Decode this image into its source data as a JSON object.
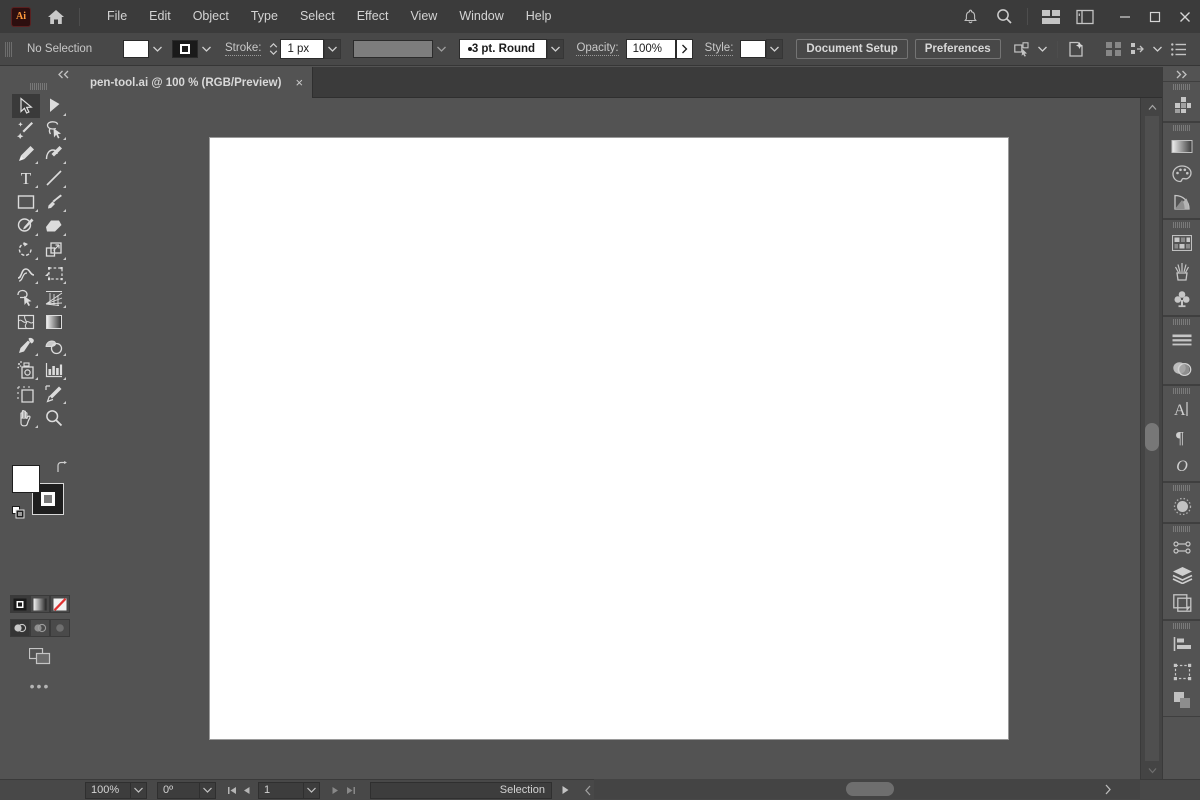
{
  "app": {
    "name": "Adobe Illustrator",
    "logo_text": "Ai",
    "accent": "#ff9a3c",
    "chrome_bg": "#3b3b3b",
    "panel_bg": "#535353",
    "control_bg": "#484848"
  },
  "menubar": {
    "items": [
      {
        "label": "File"
      },
      {
        "label": "Edit"
      },
      {
        "label": "Object"
      },
      {
        "label": "Type"
      },
      {
        "label": "Select"
      },
      {
        "label": "Effect"
      },
      {
        "label": "View"
      },
      {
        "label": "Window"
      },
      {
        "label": "Help"
      }
    ],
    "right_icons": [
      "bell-icon",
      "search-icon",
      "arrange-documents-icon",
      "workspace-switcher-icon"
    ],
    "window_controls": [
      "minimize",
      "maximize",
      "close"
    ]
  },
  "controlbar": {
    "selection_status": "No Selection",
    "fill_color": "#ffffff",
    "stroke_swatch": "#1a1a1a",
    "stroke_label": "Stroke:",
    "stroke_width": "1 px",
    "brush_definition": "3 pt. Round",
    "opacity_label": "Opacity:",
    "opacity_value": "100%",
    "style_label": "Style:",
    "style_swatch": "#ffffff",
    "document_setup_button": "Document Setup",
    "preferences_button": "Preferences",
    "right_icons": [
      "align-icon",
      "distribute-icon",
      "options-menu-icon",
      "select-similar-icon",
      "new-document-icon"
    ]
  },
  "tabs": [
    {
      "title": "pen-tool.ai @ 100 % (RGB/Preview)",
      "close_glyph": "×",
      "active": true
    }
  ],
  "toolbar": {
    "collapse_icon": "double-chevron-left-icon",
    "tools": [
      {
        "name": "selection-tool",
        "selected": true,
        "has_flyout": false
      },
      {
        "name": "direct-selection-tool",
        "selected": false,
        "has_flyout": true
      },
      {
        "name": "magic-wand-tool",
        "selected": false,
        "has_flyout": false
      },
      {
        "name": "lasso-tool",
        "selected": false,
        "has_flyout": false
      },
      {
        "name": "pen-tool",
        "selected": false,
        "has_flyout": true
      },
      {
        "name": "curvature-tool",
        "selected": false,
        "has_flyout": false
      },
      {
        "name": "type-tool",
        "selected": false,
        "has_flyout": true
      },
      {
        "name": "line-segment-tool",
        "selected": false,
        "has_flyout": true
      },
      {
        "name": "rectangle-tool",
        "selected": false,
        "has_flyout": true
      },
      {
        "name": "paintbrush-tool",
        "selected": false,
        "has_flyout": true
      },
      {
        "name": "shaper-tool",
        "selected": false,
        "has_flyout": true
      },
      {
        "name": "eraser-tool",
        "selected": false,
        "has_flyout": true
      },
      {
        "name": "rotate-tool",
        "selected": false,
        "has_flyout": true
      },
      {
        "name": "scale-tool",
        "selected": false,
        "has_flyout": true
      },
      {
        "name": "width-tool",
        "selected": false,
        "has_flyout": true
      },
      {
        "name": "free-transform-tool",
        "selected": false,
        "has_flyout": true
      },
      {
        "name": "shape-builder-tool",
        "selected": false,
        "has_flyout": true
      },
      {
        "name": "perspective-grid-tool",
        "selected": false,
        "has_flyout": true
      },
      {
        "name": "mesh-tool",
        "selected": false,
        "has_flyout": false
      },
      {
        "name": "gradient-tool",
        "selected": false,
        "has_flyout": false
      },
      {
        "name": "eyedropper-tool",
        "selected": false,
        "has_flyout": true
      },
      {
        "name": "blend-tool",
        "selected": false,
        "has_flyout": true
      },
      {
        "name": "symbol-sprayer-tool",
        "selected": false,
        "has_flyout": true
      },
      {
        "name": "column-graph-tool",
        "selected": false,
        "has_flyout": true
      },
      {
        "name": "artboard-tool",
        "selected": false,
        "has_flyout": false
      },
      {
        "name": "slice-tool",
        "selected": false,
        "has_flyout": true
      },
      {
        "name": "hand-tool",
        "selected": false,
        "has_flyout": true
      },
      {
        "name": "zoom-tool",
        "selected": false,
        "has_flyout": false
      }
    ],
    "fill_color": "#ffffff",
    "stroke_color": "#ffffff",
    "swap_icon": "swap-fill-stroke-icon",
    "default_icon": "default-fill-stroke-icon",
    "color_modes": [
      {
        "name": "color-mode",
        "active": true
      },
      {
        "name": "gradient-mode",
        "active": false
      },
      {
        "name": "none-mode",
        "active": false
      }
    ],
    "draw_modes": [
      {
        "name": "draw-normal-mode",
        "active": true
      },
      {
        "name": "draw-behind-mode",
        "active": false
      },
      {
        "name": "draw-inside-mode",
        "active": false
      }
    ],
    "screen_mode": "change-screen-mode-icon",
    "more_tools": "edit-toolbar-icon"
  },
  "canvas": {
    "artboard_fill": "#ffffff",
    "background": "#535353",
    "zoom_level": "100%"
  },
  "dock": {
    "collapse_icon": "double-chevron-right-icon",
    "groups": [
      {
        "panels": [
          {
            "name": "properties-panel-icon"
          }
        ]
      },
      {
        "panels": [
          {
            "name": "gradient-panel-icon"
          },
          {
            "name": "color-panel-icon"
          },
          {
            "name": "color-guide-panel-icon"
          }
        ]
      },
      {
        "panels": [
          {
            "name": "swatches-panel-icon"
          },
          {
            "name": "brushes-panel-icon"
          },
          {
            "name": "symbols-panel-icon"
          }
        ]
      },
      {
        "panels": [
          {
            "name": "stroke-panel-icon"
          },
          {
            "name": "transparency-panel-icon"
          }
        ]
      },
      {
        "panels": [
          {
            "name": "character-panel-icon"
          },
          {
            "name": "paragraph-panel-icon"
          },
          {
            "name": "opentype-panel-icon"
          }
        ]
      },
      {
        "panels": [
          {
            "name": "appearance-panel-icon"
          }
        ]
      },
      {
        "panels": [
          {
            "name": "graphic-styles-panel-icon"
          },
          {
            "name": "layers-panel-icon"
          },
          {
            "name": "artboards-panel-icon"
          }
        ]
      },
      {
        "panels": [
          {
            "name": "align-panel-icon"
          },
          {
            "name": "transform-panel-icon"
          },
          {
            "name": "pathfinder-panel-icon"
          }
        ]
      }
    ]
  },
  "statusbar": {
    "zoom_value": "100%",
    "rotation_value": "0º",
    "artboard_number": "1",
    "status_text": "Selection",
    "nav_first": "first-artboard-icon",
    "nav_prev": "previous-artboard-icon",
    "nav_next": "next-artboard-icon",
    "nav_last": "last-artboard-icon"
  }
}
